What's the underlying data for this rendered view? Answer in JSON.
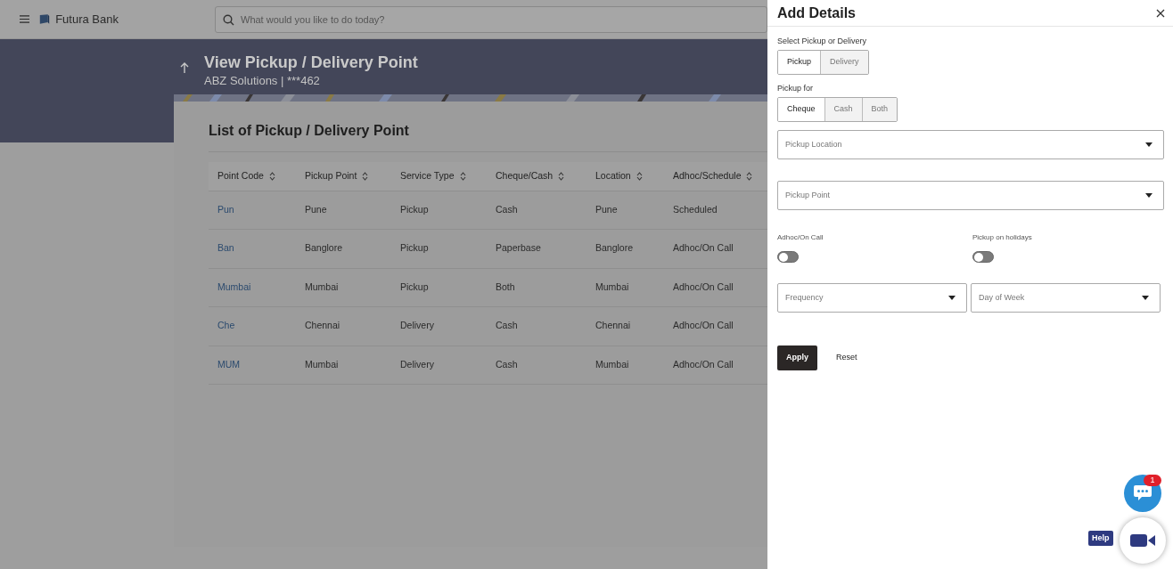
{
  "header": {
    "brand": "Futura Bank",
    "search_placeholder": "What would you like to do today?"
  },
  "page": {
    "title": "View Pickup / Delivery Point",
    "subtitle": "ABZ Solutions | ***462"
  },
  "list": {
    "title": "List of Pickup / Delivery Point",
    "columns": [
      "Point Code",
      "Pickup Point",
      "Service Type",
      "Cheque/Cash",
      "Location",
      "Adhoc/Schedule"
    ],
    "rows": [
      [
        "Pun",
        "Pune",
        "Pickup",
        "Cash",
        "Pune",
        "Scheduled"
      ],
      [
        "Ban",
        "Banglore",
        "Pickup",
        "Paperbase",
        "Banglore",
        "Adhoc/On Call"
      ],
      [
        "Mumbai",
        "Mumbai",
        "Pickup",
        "Both",
        "Mumbai",
        "Adhoc/On Call"
      ],
      [
        "Che",
        "Chennai",
        "Delivery",
        "Cash",
        "Chennai",
        "Adhoc/On Call"
      ],
      [
        "MUM",
        "Mumbai",
        "Delivery",
        "Cash",
        "Mumbai",
        "Adhoc/On Call"
      ]
    ]
  },
  "drawer": {
    "title": "Add Details",
    "groups": [
      {
        "label": "Select Pickup or Delivery",
        "options": [
          {
            "label": "Pickup",
            "selected": true
          },
          {
            "label": "Delivery",
            "selected": false
          }
        ]
      },
      {
        "label": "Pickup for",
        "options": [
          {
            "label": "Cheque",
            "selected": true
          },
          {
            "label": "Cash",
            "selected": false
          },
          {
            "label": "Both",
            "selected": false
          }
        ]
      }
    ],
    "selects_full": [
      {
        "placeholder": "Pickup Location"
      },
      {
        "placeholder": "Pickup Point"
      }
    ],
    "toggles": [
      {
        "label": "Adhoc/On Call",
        "on": false
      },
      {
        "label": "Pickup on holidays",
        "on": false
      }
    ],
    "selects_half": [
      {
        "placeholder": "Frequency"
      },
      {
        "placeholder": "Day of Week"
      }
    ],
    "apply": "Apply",
    "reset": "Reset"
  },
  "chat": {
    "badge": "1"
  },
  "help": "Help"
}
